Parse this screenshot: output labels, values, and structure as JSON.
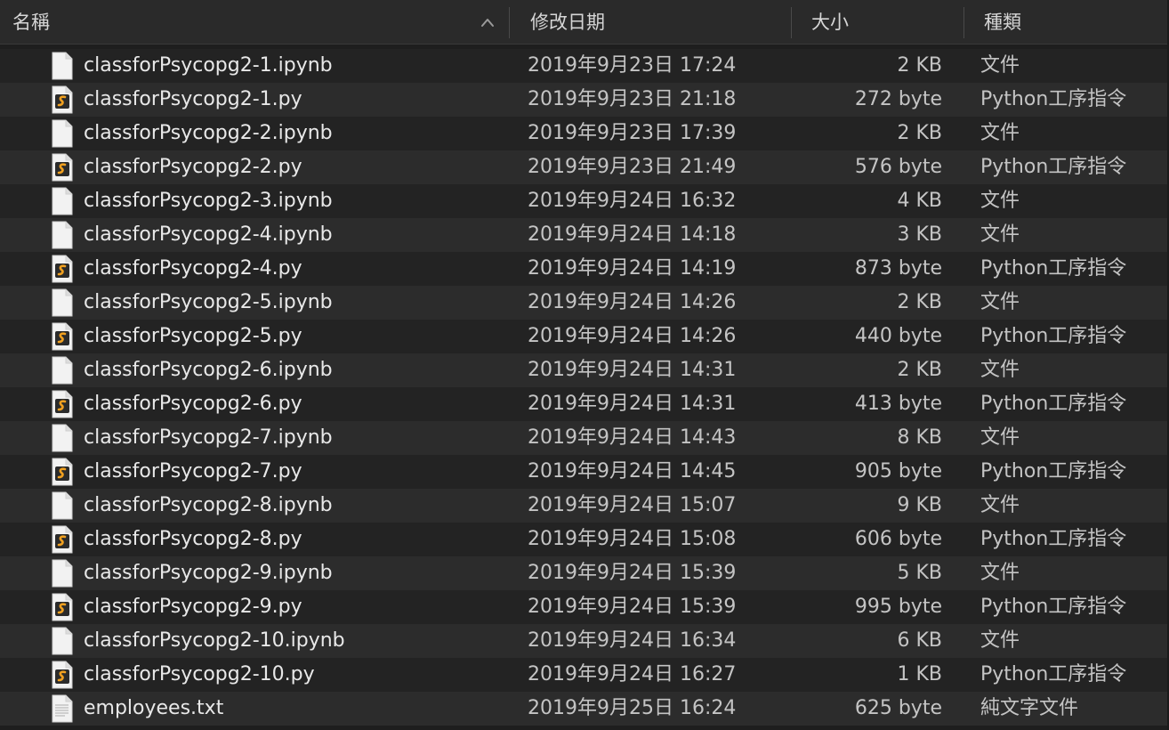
{
  "header": {
    "name_label": "名稱",
    "date_label": "修改日期",
    "size_label": "大小",
    "kind_label": "種類",
    "sort_icon": "chevron-up-icon"
  },
  "colors": {
    "background": "#1e1e1e",
    "row_alt": "#2c2c2c",
    "header_bg": "#2a2a2a",
    "python_icon_accent": "#f0a020",
    "text": "#e8e8e8"
  },
  "files": [
    {
      "name": "classforPsycopg2-1.ipynb",
      "date": "2019年9月23日 17:24",
      "size": "2 KB",
      "kind": "文件",
      "icon": "document-icon"
    },
    {
      "name": "classforPsycopg2-1.py",
      "date": "2019年9月23日 21:18",
      "size": "272 byte",
      "kind": "Python工序指令",
      "icon": "python-script-icon"
    },
    {
      "name": "classforPsycopg2-2.ipynb",
      "date": "2019年9月23日 17:39",
      "size": "2 KB",
      "kind": "文件",
      "icon": "document-icon"
    },
    {
      "name": "classforPsycopg2-2.py",
      "date": "2019年9月23日 21:49",
      "size": "576 byte",
      "kind": "Python工序指令",
      "icon": "python-script-icon"
    },
    {
      "name": "classforPsycopg2-3.ipynb",
      "date": "2019年9月24日 16:32",
      "size": "4 KB",
      "kind": "文件",
      "icon": "document-icon"
    },
    {
      "name": "classforPsycopg2-4.ipynb",
      "date": "2019年9月24日 14:18",
      "size": "3 KB",
      "kind": "文件",
      "icon": "document-icon"
    },
    {
      "name": "classforPsycopg2-4.py",
      "date": "2019年9月24日 14:19",
      "size": "873 byte",
      "kind": "Python工序指令",
      "icon": "python-script-icon"
    },
    {
      "name": "classforPsycopg2-5.ipynb",
      "date": "2019年9月24日 14:26",
      "size": "2 KB",
      "kind": "文件",
      "icon": "document-icon"
    },
    {
      "name": "classforPsycopg2-5.py",
      "date": "2019年9月24日 14:26",
      "size": "440 byte",
      "kind": "Python工序指令",
      "icon": "python-script-icon"
    },
    {
      "name": "classforPsycopg2-6.ipynb",
      "date": "2019年9月24日 14:31",
      "size": "2 KB",
      "kind": "文件",
      "icon": "document-icon"
    },
    {
      "name": "classforPsycopg2-6.py",
      "date": "2019年9月24日 14:31",
      "size": "413 byte",
      "kind": "Python工序指令",
      "icon": "python-script-icon"
    },
    {
      "name": "classforPsycopg2-7.ipynb",
      "date": "2019年9月24日 14:43",
      "size": "8 KB",
      "kind": "文件",
      "icon": "document-icon"
    },
    {
      "name": "classforPsycopg2-7.py",
      "date": "2019年9月24日 14:45",
      "size": "905 byte",
      "kind": "Python工序指令",
      "icon": "python-script-icon"
    },
    {
      "name": "classforPsycopg2-8.ipynb",
      "date": "2019年9月24日 15:07",
      "size": "9 KB",
      "kind": "文件",
      "icon": "document-icon"
    },
    {
      "name": "classforPsycopg2-8.py",
      "date": "2019年9月24日 15:08",
      "size": "606 byte",
      "kind": "Python工序指令",
      "icon": "python-script-icon"
    },
    {
      "name": "classforPsycopg2-9.ipynb",
      "date": "2019年9月24日 15:39",
      "size": "5 KB",
      "kind": "文件",
      "icon": "document-icon"
    },
    {
      "name": "classforPsycopg2-9.py",
      "date": "2019年9月24日 15:39",
      "size": "995 byte",
      "kind": "Python工序指令",
      "icon": "python-script-icon"
    },
    {
      "name": "classforPsycopg2-10.ipynb",
      "date": "2019年9月24日 16:34",
      "size": "6 KB",
      "kind": "文件",
      "icon": "document-icon"
    },
    {
      "name": "classforPsycopg2-10.py",
      "date": "2019年9月24日 16:27",
      "size": "1 KB",
      "kind": "Python工序指令",
      "icon": "python-script-icon"
    },
    {
      "name": "employees.txt",
      "date": "2019年9月25日 16:24",
      "size": "625 byte",
      "kind": "純文字文件",
      "icon": "text-document-icon"
    }
  ]
}
